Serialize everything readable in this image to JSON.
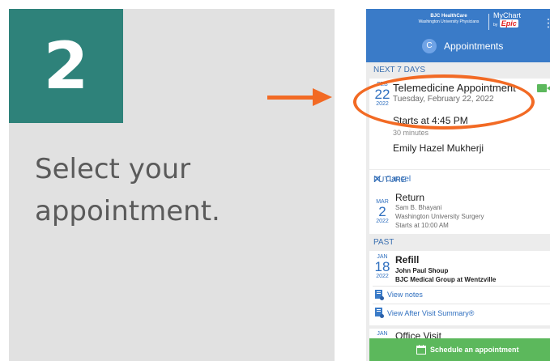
{
  "slide": {
    "step_number": "2",
    "instruction": "Select your appointment."
  },
  "colors": {
    "teal": "#2e827a",
    "orange": "#f26a24",
    "app_blue": "#3a7bc8",
    "link_blue": "#2f6fbf",
    "green": "#5cb85c"
  },
  "header": {
    "org_name": "BJC HealthCare",
    "org_sub": "Washington University Physicians",
    "app_name": "MyChart",
    "by": "by",
    "vendor": "Epic",
    "avatar_initial": "C",
    "title": "Appointments"
  },
  "sections": {
    "next": "NEXT 7 DAYS",
    "future": "FUTURE",
    "past": "PAST"
  },
  "next_appointment": {
    "month": "FEB",
    "day": "22",
    "year": "2022",
    "title": "Telemedicine Appointment",
    "date_text": "Tuesday, February 22, 2022",
    "starts": "Starts at 4:45 PM",
    "duration": "30 minutes",
    "provider": "Emily Hazel Mukherji",
    "cancel_label": "Cancel"
  },
  "future_appointment": {
    "month": "MAR",
    "day": "2",
    "year": "2022",
    "title": "Return",
    "provider": "Sam B. Bhayani",
    "location": "Washington University Surgery",
    "starts": "Starts at 10:00 AM"
  },
  "past_appointment": {
    "month": "JAN",
    "day": "18",
    "year": "2022",
    "title": "Refill",
    "provider": "John Paul Shoup",
    "location": "BJC Medical Group at Wentzville",
    "view_notes": "View notes",
    "view_avs": "View After Visit Summary®"
  },
  "past_appointment_2": {
    "month": "JAN",
    "title": "Office Visit"
  },
  "schedule_button": "Schedule an appointment"
}
